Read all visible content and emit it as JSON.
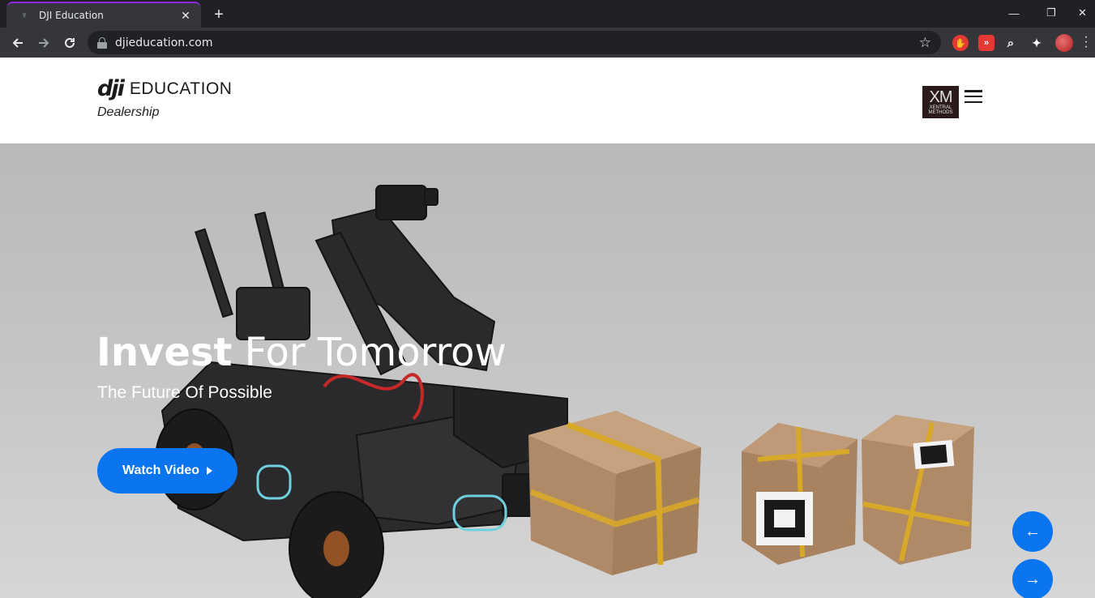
{
  "browser": {
    "tab_title": "DJI Education",
    "url": "djieducation.com",
    "new_tab_glyph": "+",
    "close_glyph": "✕",
    "window_controls": [
      "—",
      "❐",
      "✕"
    ],
    "extensions": [
      {
        "name": "adblock-icon",
        "glyph": "✋",
        "color": "#e53935"
      },
      {
        "name": "fast-forward-icon",
        "glyph": "»",
        "color": "#e53935"
      },
      {
        "name": "search-extension-icon",
        "glyph": "⌕",
        "color": "#35363a"
      },
      {
        "name": "puzzle-icon",
        "glyph": "✦",
        "color": "#35363a"
      }
    ]
  },
  "site": {
    "logo_mark": "dji",
    "logo_word": "EDUCATION",
    "logo_sub": "Dealership",
    "partner_logo_big": "XM",
    "partner_logo_small": "XENTRAL METHODS"
  },
  "hero": {
    "title_bold": "Invest",
    "title_light": " For Tomorrow",
    "subtitle": "The Future Of Possible",
    "cta_label": "Watch Video",
    "prev_glyph": "←",
    "next_glyph": "→"
  },
  "colors": {
    "accent": "#0a75ee",
    "tab_accent": "#8a2be2"
  }
}
